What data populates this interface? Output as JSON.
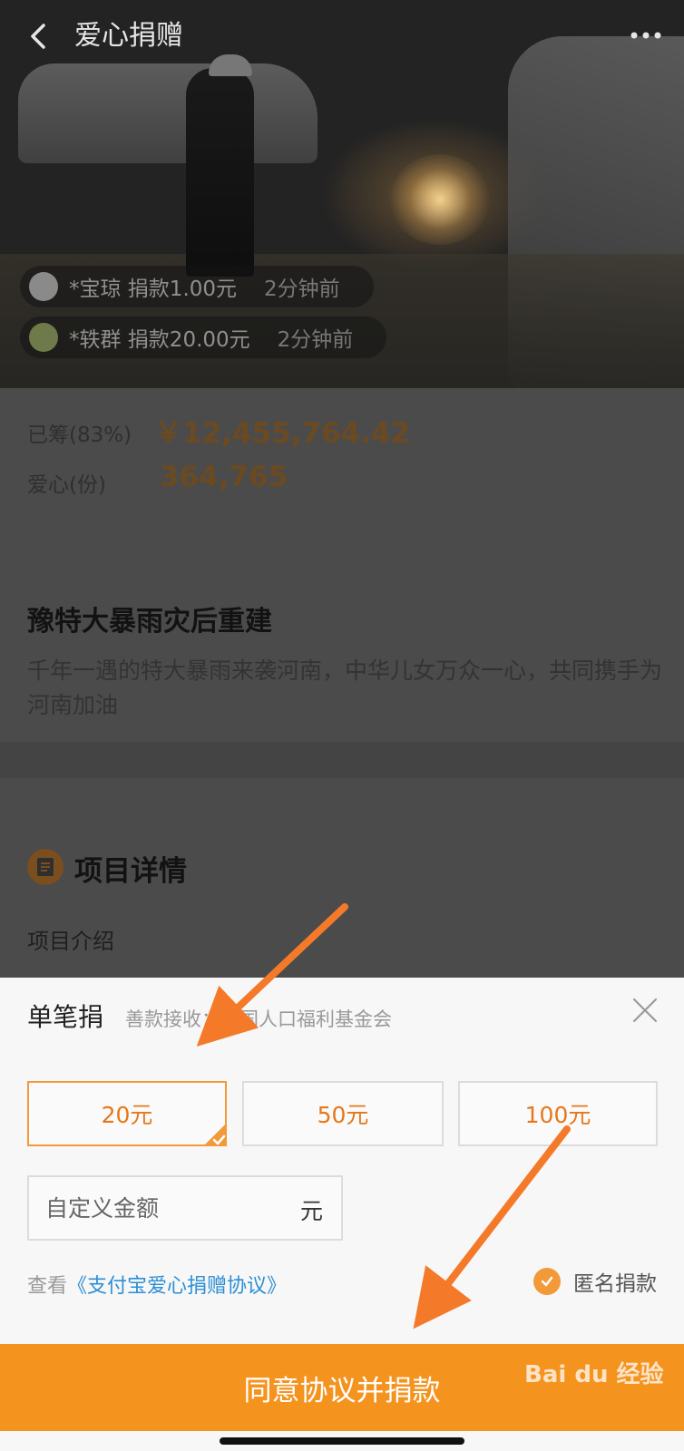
{
  "header": {
    "title": "爱心捐赠"
  },
  "ticker": [
    {
      "text": "*宝琼 捐款1.00元",
      "time": "2分钟前"
    },
    {
      "text": "*轶群 捐款20.00元",
      "time": "2分钟前"
    }
  ],
  "stats": {
    "raised_label": "已筹(83%)",
    "raised_value": "￥12,455,764.42",
    "hearts_label": "爱心(份)",
    "hearts_value": "364,765"
  },
  "project": {
    "title": "豫特大暴雨灾后重建",
    "description": "千年一遇的特大暴雨来袭河南，中华儿女万众一心，共同携手为河南加油",
    "details_title": "项目详情",
    "intro_label": "项目介绍"
  },
  "donation_sheet": {
    "title": "单笔捐",
    "recipient": "善款接收：中国人口福利基金会",
    "amounts": [
      "20元",
      "50元",
      "100元"
    ],
    "selected_amount": "20元",
    "custom_placeholder": "自定义金额",
    "custom_unit": "元",
    "agreement_prefix": "查看",
    "agreement_link": "《支付宝爱心捐赠协议》",
    "anonymous_label": "匿名捐款",
    "anonymous_checked": true,
    "submit_label": "同意协议并捐款"
  },
  "watermark": "Bai du 经验",
  "colors": {
    "accent": "#f5931f",
    "link": "#2d8fd4",
    "amount_text": "#e5781b"
  }
}
